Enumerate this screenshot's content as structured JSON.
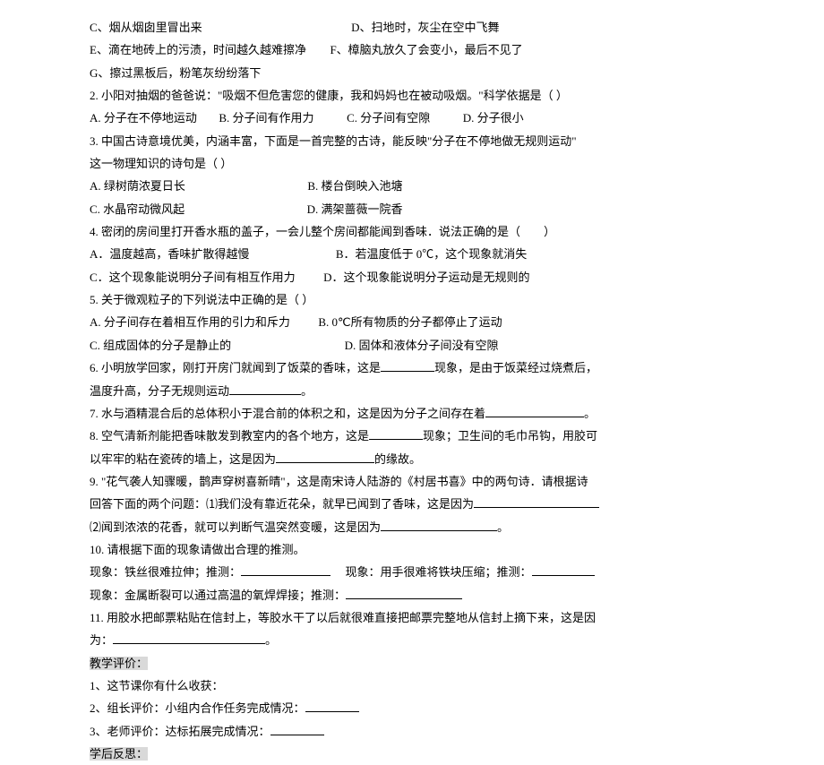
{
  "q1_options": {
    "c": "C、烟从烟囱里冒出来",
    "d": "D、扫地时，灰尘在空中飞舞",
    "e": "E、滴在地砖上的污渍，时间越久越难擦净",
    "f": "F、樟脑丸放久了会变小，最后不见了",
    "g": "G、擦过黑板后，粉笔灰纷纷落下"
  },
  "q2": {
    "stem": "2. 小阳对抽烟的爸爸说：\"吸烟不但危害您的健康，我和妈妈也在被动吸烟。\"科学依据是（    ）",
    "a": "A. 分子在不停地运动",
    "b": "B. 分子间有作用力",
    "c": "C. 分子间有空隙",
    "d": "D. 分子很小"
  },
  "q3": {
    "stem1": "3. 中国古诗意境优美，内涵丰富，下面是一首完整的古诗，能反映\"分子在不停地做无规则运动\"",
    "stem2": "这一物理知识的诗句是（   ）",
    "a": "A. 绿树荫浓夏日长",
    "b": "B. 楼台倒映入池塘",
    "c": "C. 水晶帘动微风起",
    "d": "D. 满架蔷薇一院香"
  },
  "q4": {
    "stem": "4. 密闭的房间里打开香水瓶的盖子，一会儿整个房间都能闻到香味．说法正确的是（　　）",
    "a": "A．温度越高，香味扩散得越慢",
    "b": "B．若温度低于 0℃，这个现象就消失",
    "c": "C．这个现象能说明分子间有相互作用力",
    "d": "D．这个现象能说明分子运动是无规则的"
  },
  "q5": {
    "stem": "5. 关于微观粒子的下列说法中正确的是（     ）",
    "a": "A. 分子间存在着相互作用的引力和斥力",
    "b": "B. 0℃所有物质的分子都停止了运动",
    "c": "C. 组成固体的分子是静止的",
    "d": "D. 固体和液体分子间没有空隙"
  },
  "q6": {
    "part1": "6. 小明放学回家，刚打开房门就闻到了饭菜的香味，这是",
    "part2": "现象，是由于饭菜经过烧煮后，",
    "part3": "温度升高，分子无规则运动",
    "part4": "。"
  },
  "q7": {
    "part1": "7. 水与酒精混合后的总体积小于混合前的体积之和，这是因为分子之间存在着",
    "part2": "。"
  },
  "q8": {
    "part1": "8. 空气清新剂能把香味散发到教室内的各个地方，这是",
    "part2": "现象；卫生间的毛巾吊钩，用胶可",
    "part3": "以牢牢的粘在瓷砖的墙上，这是因为",
    "part4": "的缘故。"
  },
  "q9": {
    "stem": "9. \"花气袭人知骤暖，鹊声穿树喜新晴\"，这是南宋诗人陆游的《村居书喜》中的两句诗．请根据诗",
    "sub1a": "回答下面的两个问题：⑴我们没有靠近花朵，就早已闻到了香味，这是因为",
    "sub1b": "",
    "sub2a": "⑵闻到浓浓的花香，就可以判断气温突然变暖，这是因为",
    "sub2b": "。"
  },
  "q10": {
    "stem": "10. 请根据下面的现象请做出合理的推测。",
    "row1a": "现象：铁丝很难拉伸；推测：",
    "row1b": "现象：用手很难将铁块压缩；推测：",
    "row2a": "现象：金属断裂可以通过高温的氧焊焊接；推测：",
    "row2b": ""
  },
  "q11": {
    "part1": "11. 用胶水把邮票粘贴在信封上，等胶水干了以后就很难直接把邮票完整地从信封上摘下来，这是因",
    "part2": "为：",
    "part3": "。"
  },
  "eval": {
    "header": "教学评价：",
    "i1": "1、这节课你有什么收获：",
    "i2": "2、组长评价：小组内合作任务完成情况：",
    "i3": "3、老师评价：达标拓展完成情况：",
    "reflection": "学后反思："
  }
}
